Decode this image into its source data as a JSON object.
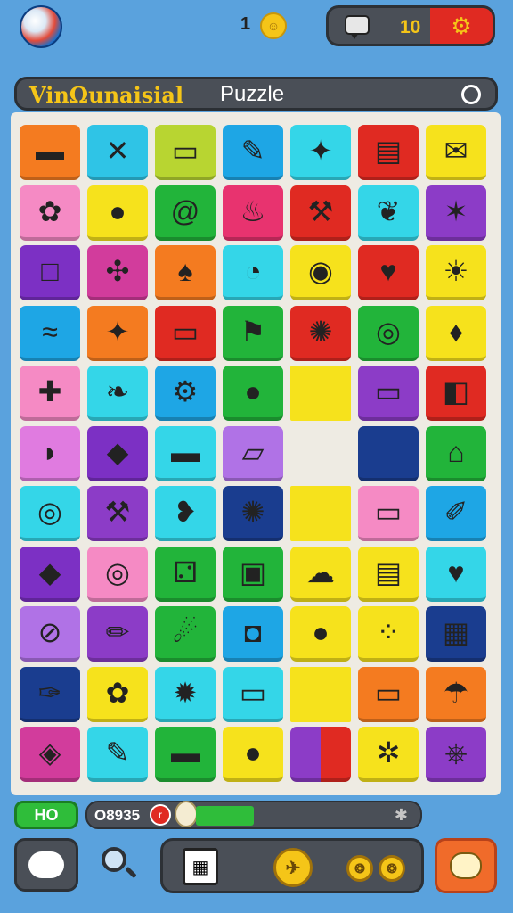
{
  "header": {
    "coin_count": "1",
    "message_count": "10"
  },
  "title_bar": {
    "game_name": "VinΩunaisial",
    "title": "Puzzle"
  },
  "board": {
    "tiles": [
      {
        "name": "flag",
        "color": "#f47b20",
        "glyph": "▬"
      },
      {
        "name": "cross",
        "color": "#2fc4e6",
        "glyph": "✕"
      },
      {
        "name": "ruler",
        "color": "#b8d531",
        "glyph": "▭"
      },
      {
        "name": "paint-brush",
        "color": "#1ea6e5",
        "glyph": "✎"
      },
      {
        "name": "bird",
        "color": "#34d6e8",
        "glyph": "✦"
      },
      {
        "name": "card",
        "color": "#e02a22",
        "glyph": "▤"
      },
      {
        "name": "envelope",
        "color": "#f6e21c",
        "glyph": "✉"
      },
      {
        "name": "star-flower",
        "color": "#f58ac4",
        "glyph": "✿"
      },
      {
        "name": "swirl-ball",
        "color": "#f6e21c",
        "glyph": "●"
      },
      {
        "name": "spiral",
        "color": "#22b43a",
        "glyph": "@"
      },
      {
        "name": "cake",
        "color": "#e8336f",
        "glyph": "♨"
      },
      {
        "name": "hammer",
        "color": "#e02a22",
        "glyph": "⚒"
      },
      {
        "name": "leaf",
        "color": "#34d6e8",
        "glyph": "❦"
      },
      {
        "name": "sparkle",
        "color": "#8c3cc7",
        "glyph": "✶"
      },
      {
        "name": "square",
        "color": "#7c30c4",
        "glyph": "□"
      },
      {
        "name": "arrows",
        "color": "#d23c9c",
        "glyph": "✣"
      },
      {
        "name": "balloon",
        "color": "#f47b20",
        "glyph": "♠"
      },
      {
        "name": "bean",
        "color": "#34d6e8",
        "glyph": "◔"
      },
      {
        "name": "orb",
        "color": "#f6e21c",
        "glyph": "◉"
      },
      {
        "name": "heart",
        "color": "#e02a22",
        "glyph": "♥"
      },
      {
        "name": "sun",
        "color": "#f6e21c",
        "glyph": "☀"
      },
      {
        "name": "fish",
        "color": "#1ea6e5",
        "glyph": "≈"
      },
      {
        "name": "sparkle-star",
        "color": "#f47b20",
        "glyph": "✦"
      },
      {
        "name": "white-box",
        "color": "#e02a22",
        "glyph": "▭"
      },
      {
        "name": "red-flag",
        "color": "#22b43a",
        "glyph": "⚑"
      },
      {
        "name": "badge",
        "color": "#e02a22",
        "glyph": "✺"
      },
      {
        "name": "target",
        "color": "#22b43a",
        "glyph": "◎"
      },
      {
        "name": "ice-cream",
        "color": "#f6e21c",
        "glyph": "♦"
      },
      {
        "name": "cross-bone",
        "color": "#f58ac4",
        "glyph": "✚"
      },
      {
        "name": "leaf-green",
        "color": "#34d6e8",
        "glyph": "❧"
      },
      {
        "name": "gear",
        "color": "#1ea6e5",
        "glyph": "⚙"
      },
      {
        "name": "red-ball",
        "color": "#22b43a",
        "glyph": "●"
      },
      {
        "name": "blank-yellow",
        "color": "#f6e21c",
        "glyph": ""
      },
      {
        "name": "card-small",
        "color": "#8c3cc7",
        "glyph": "▭"
      },
      {
        "name": "cup",
        "color": "#e02a22",
        "glyph": "◧"
      },
      {
        "name": "shell",
        "color": "#e07be0",
        "glyph": "◗"
      },
      {
        "name": "box",
        "color": "#7c30c4",
        "glyph": "◆"
      },
      {
        "name": "yellow-bar",
        "color": "#34d6e8",
        "glyph": "▬"
      },
      {
        "name": "scroll",
        "color": "#b072e6",
        "glyph": "▱"
      },
      {
        "name": "empty",
        "color": "#eeebe3",
        "glyph": ""
      },
      {
        "name": "dark-blue",
        "color": "#1a3d8f",
        "glyph": ""
      },
      {
        "name": "house",
        "color": "#22b43a",
        "glyph": "⌂"
      },
      {
        "name": "coil",
        "color": "#34d6e8",
        "glyph": "◎"
      },
      {
        "name": "axe",
        "color": "#8c3cc7",
        "glyph": "⚒"
      },
      {
        "name": "bird-pink",
        "color": "#34d6e8",
        "glyph": "❥"
      },
      {
        "name": "virus",
        "color": "#1a3d8f",
        "glyph": "✺"
      },
      {
        "name": "yellow-block",
        "color": "#f6e21c",
        "glyph": ""
      },
      {
        "name": "label",
        "color": "#f58ac4",
        "glyph": "▭"
      },
      {
        "name": "marker",
        "color": "#1ea6e5",
        "glyph": "✐"
      },
      {
        "name": "geode",
        "color": "#7c30c4",
        "glyph": "◆"
      },
      {
        "name": "rings",
        "color": "#f58ac4",
        "glyph": "◎"
      },
      {
        "name": "dice",
        "color": "#22b43a",
        "glyph": "⚁"
      },
      {
        "name": "radio",
        "color": "#22b43a",
        "glyph": "▣"
      },
      {
        "name": "cloud",
        "color": "#f6e21c",
        "glyph": "☁"
      },
      {
        "name": "ticket",
        "color": "#f6e21c",
        "glyph": "▤"
      },
      {
        "name": "apple",
        "color": "#34d6e8",
        "glyph": "♥"
      },
      {
        "name": "stripe-ball",
        "color": "#b072e6",
        "glyph": "⊘"
      },
      {
        "name": "pencil",
        "color": "#8c3cc7",
        "glyph": "✏"
      },
      {
        "name": "comet",
        "color": "#22b43a",
        "glyph": "☄"
      },
      {
        "name": "bag",
        "color": "#1ea6e5",
        "glyph": "◘"
      },
      {
        "name": "blue-ball",
        "color": "#f6e21c",
        "glyph": "●"
      },
      {
        "name": "cheese",
        "color": "#f6e21c",
        "glyph": "⁘"
      },
      {
        "name": "spotted-card",
        "color": "#1a3d8f",
        "glyph": "▦"
      },
      {
        "name": "knife",
        "color": "#1a3d8f",
        "glyph": "✑"
      },
      {
        "name": "red-blob",
        "color": "#f6e21c",
        "glyph": "✿"
      },
      {
        "name": "sun-burst",
        "color": "#34d6e8",
        "glyph": "✹"
      },
      {
        "name": "flag-card",
        "color": "#34d6e8",
        "glyph": "▭"
      },
      {
        "name": "yellow-strip",
        "color": "#f6e21c",
        "glyph": ""
      },
      {
        "name": "scroll-paper",
        "color": "#f47b20",
        "glyph": "▭"
      },
      {
        "name": "umbrella",
        "color": "#f47b20",
        "glyph": "☂"
      },
      {
        "name": "chip",
        "color": "#d23c9c",
        "glyph": "◈"
      },
      {
        "name": "carrot",
        "color": "#34d6e8",
        "glyph": "✎"
      },
      {
        "name": "flag-green",
        "color": "#22b43a",
        "glyph": "▬"
      },
      {
        "name": "ball",
        "color": "#f6e21c",
        "glyph": "●"
      },
      {
        "name": "purple-red",
        "color": "#8c3cc7",
        "glyph": ""
      },
      {
        "name": "spiky-flower",
        "color": "#f6e21c",
        "glyph": "✲"
      },
      {
        "name": "clip",
        "color": "#8c3cc7",
        "glyph": "⎈"
      }
    ]
  },
  "footer": {
    "score": "HO",
    "progress_label": "O8935",
    "progress_value": 0.27
  }
}
